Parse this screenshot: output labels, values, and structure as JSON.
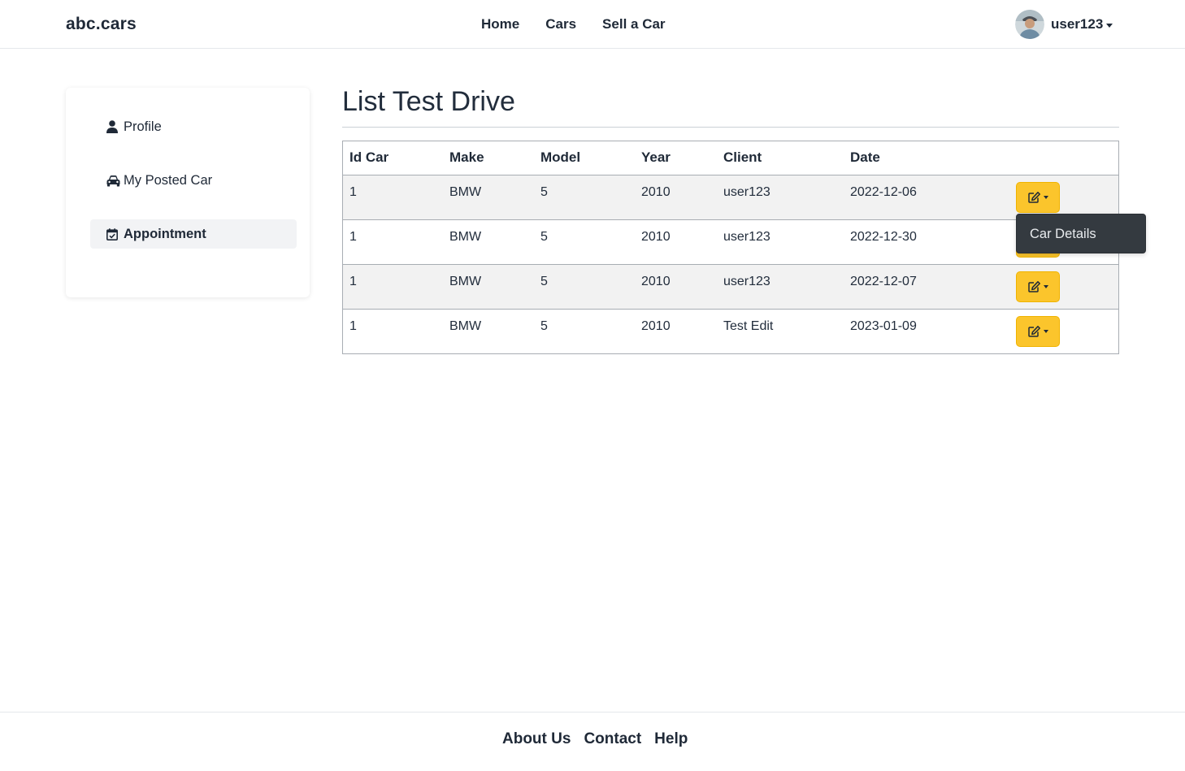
{
  "navbar": {
    "brand": "abc.cars",
    "links": [
      "Home",
      "Cars",
      "Sell a Car"
    ],
    "user_name": "user123"
  },
  "sidebar": {
    "items": [
      {
        "label": "Profile",
        "icon": "user-icon"
      },
      {
        "label": "My Posted Car",
        "icon": "car-icon"
      },
      {
        "label": "Appointment",
        "icon": "calendar-check-icon",
        "active": true
      }
    ]
  },
  "main": {
    "title": "List Test Drive",
    "columns": [
      "Id Car",
      "Make",
      "Model",
      "Year",
      "Client",
      "Date"
    ],
    "rows": [
      [
        "1",
        "BMW",
        "5",
        "2010",
        "user123",
        "2022-12-06"
      ],
      [
        "1",
        "BMW",
        "5",
        "2010",
        "user123",
        "2022-12-30"
      ],
      [
        "1",
        "BMW",
        "5",
        "2010",
        "user123",
        "2022-12-07"
      ],
      [
        "1",
        "BMW",
        "5",
        "2010",
        "Test Edit",
        "2023-01-09"
      ]
    ],
    "action_icon": "edit-icon",
    "dropdown": {
      "item": "Car Details"
    }
  },
  "footer": {
    "links": [
      "About Us",
      "Contact",
      "Help"
    ]
  },
  "colors": {
    "action_button": "#fbc52c",
    "dropdown_bg": "#343a40",
    "row_stripe": "#f2f2f2"
  }
}
